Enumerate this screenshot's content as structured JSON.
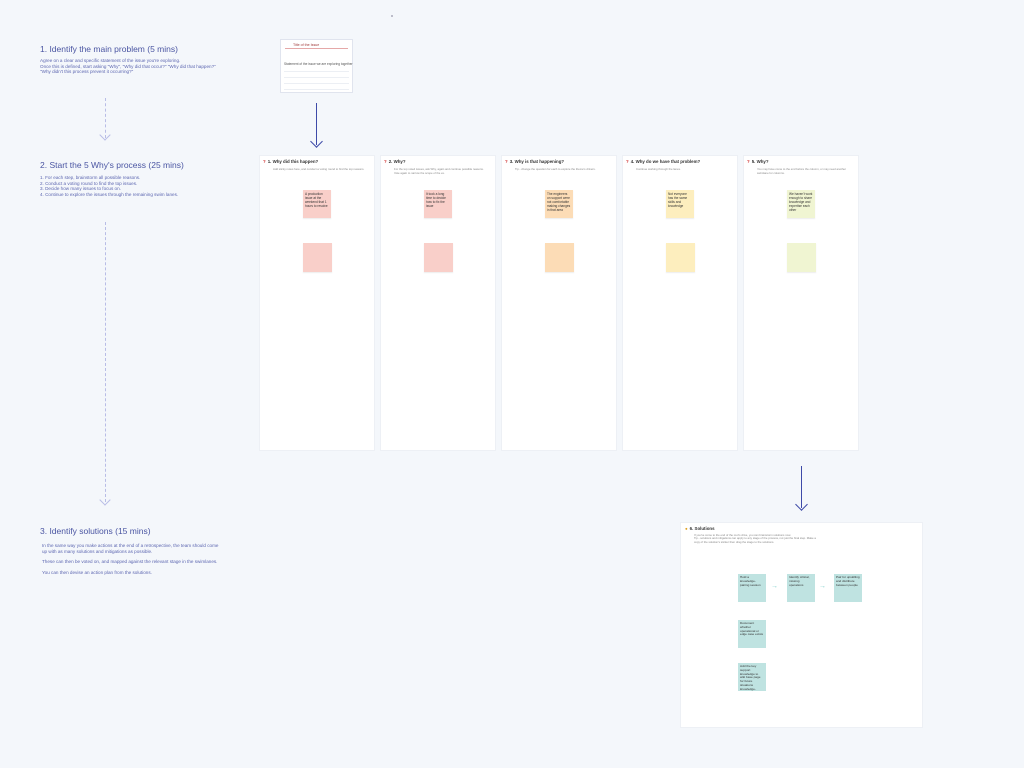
{
  "steps": [
    {
      "title": "1. Identify the main problem (5 mins)",
      "lines": [
        "Agree on a clear and specific statement of the issue you're exploring.",
        "Once this is defined, start asking \"Why\", \"Why did that occur?\" \"Why did that happen?\"",
        "\"Why didn't this process prevent it occurring?\""
      ]
    },
    {
      "title": "2. Start the 5 Why's process (25 mins)",
      "lines": [
        "1. For each step, brainstorm all possible reasons.",
        "2. Conduct a voting round to find the top issues.",
        "3. Decide how many issues to focus on.",
        "4. Continue to explore the issues through the remaining swim lanes."
      ]
    },
    {
      "title": "3. Identify solutions (15 mins)",
      "lines": [
        "In the same way you make actions at the end of a retrospective, the team should come",
        "up with as many solutions and mitigations as possible.",
        "These can then be voted on, and mapped against the relevant stage in the swimlanes.",
        "You can then devise an action plan from the solutions."
      ]
    }
  ],
  "issue_card": {
    "title": "Title of the Issue",
    "statement": "Statement of the issue we are exploring together"
  },
  "lanes": [
    {
      "heading": "1. Why did this happen?",
      "desc": "Add sticky notes here, and conduct a voting round to find the top reasons.",
      "note": "A production issue at the weekend that 1 hours to resolve",
      "color": "#f9cfc9"
    },
    {
      "heading": "2. Why?",
      "desc": "For the top voted issues, ask Why, again and continue possible reasons. Vote again to narrow the scope of the ex.",
      "note": "It took a long time to decide how to fix the issue",
      "color": "#f9cfc9"
    },
    {
      "heading": "3. Why is that happening?",
      "desc": "Tip - change the question for each to explore the theme's drivers.",
      "note": "The engineers on support were not comfortable making changes in that area",
      "color": "#fcdcb6"
    },
    {
      "heading": "4. Why do we have that problem?",
      "desc": "Continue working through the lanes.",
      "note": "Not everyone has the same skills and knowledge",
      "color": "#fdeebe"
    },
    {
      "heading": "5. Why?",
      "desc": "You may have come to the end before the column, or may need another swimlane for columns.",
      "note": "We haven't work enough to share knowledge and expertise each other",
      "color": "#f0f5d2"
    }
  ],
  "solutions": {
    "heading": "6. Solutions",
    "desc": [
      "If you've come to the end of the root's drive, you can brainstorm solutions now.",
      "Tip - solutions and mitigations can apply to any stage of the process, not just the final step. Make a",
      "copy of the solution's sticker then drag the stage to the solutions."
    ],
    "notes": [
      "Hold a knowledge-pairing session",
      "Identify critical, missing operations",
      "Pair for upskilling and distribute between people",
      "Document whether operational or edge case exists",
      "Add the key support knowledge to wiki base page for future situations knowledge-sharing"
    ],
    "note_color": "#bfe3e1"
  },
  "colors": {
    "background": "#f4f7fb",
    "step_text": "#4a55a2",
    "arrow": "#3d4aa8",
    "dashed": "#b8bde6"
  },
  "icons": [
    "question-mark-icon",
    "lightbulb-icon",
    "arrow-down-icon",
    "arrow-right-icon"
  ]
}
